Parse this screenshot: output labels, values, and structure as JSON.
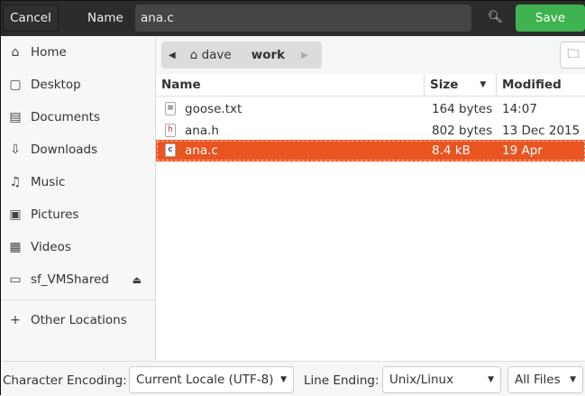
{
  "header": {
    "cancel": "Cancel",
    "name_label": "Name",
    "filename": "ana.c",
    "save": "Save"
  },
  "sidebar": {
    "items": [
      {
        "label": "Home",
        "icon": "⌂"
      },
      {
        "label": "Desktop",
        "icon": "▢"
      },
      {
        "label": "Documents",
        "icon": "▤"
      },
      {
        "label": "Downloads",
        "icon": "⇩"
      },
      {
        "label": "Music",
        "icon": "♫"
      },
      {
        "label": "Pictures",
        "icon": "▣"
      },
      {
        "label": "Videos",
        "icon": "▦"
      },
      {
        "label": "sf_VMShared",
        "icon": "▭"
      }
    ],
    "other": "Other Locations"
  },
  "path": {
    "crumbs": [
      "dave",
      "work"
    ]
  },
  "columns": {
    "name": "Name",
    "size": "Size",
    "modified": "Modified"
  },
  "files": [
    {
      "name": "goose.txt",
      "size": "164 bytes",
      "modified": "14:07",
      "icon": "≡"
    },
    {
      "name": "ana.h",
      "size": "802 bytes",
      "modified": "13 Dec 2015",
      "icon": "h"
    },
    {
      "name": "ana.c",
      "size": "8.4 kB",
      "modified": "19 Apr",
      "icon": "c"
    }
  ],
  "footer": {
    "encoding_label": "Character Encoding:",
    "encoding": "Current Locale (UTF-8)",
    "line_label": "Line Ending:",
    "line": "Unix/Linux",
    "filter": "All Files"
  },
  "colors": {
    "accent": "#e95420",
    "save": "#3eb34f"
  }
}
